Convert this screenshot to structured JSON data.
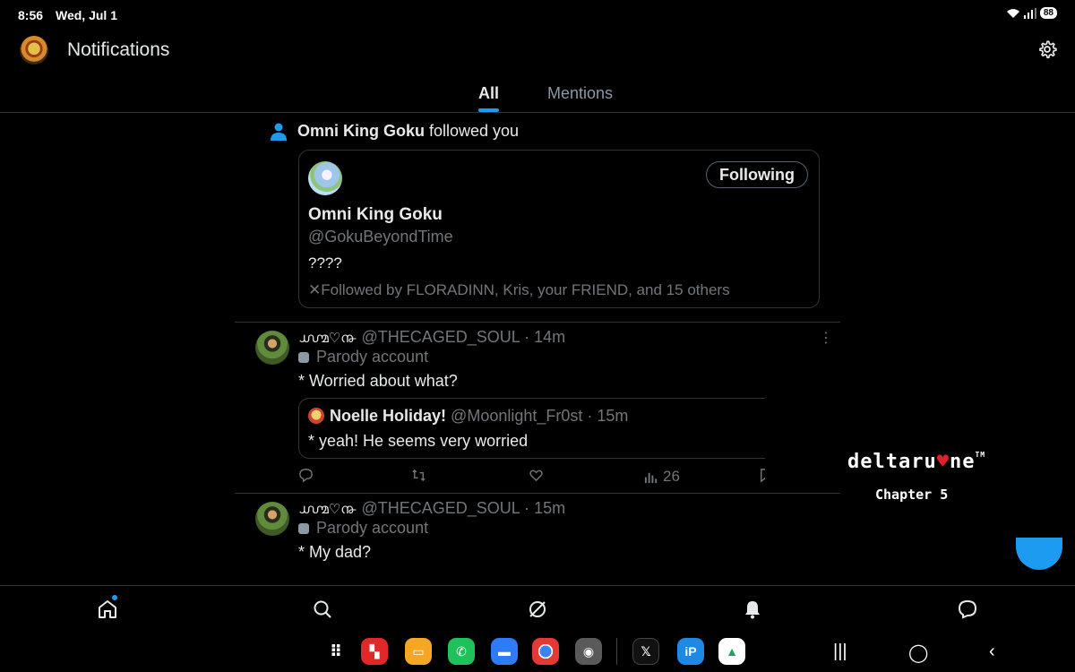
{
  "status_bar": {
    "time": "8:56",
    "date": "Wed, Jul 1",
    "battery": "88"
  },
  "header": {
    "title": "Notifications"
  },
  "tabs": [
    {
      "label": "All",
      "active": true
    },
    {
      "label": "Mentions",
      "active": false
    }
  ],
  "follow_notification": {
    "name": "Omni King Goku",
    "text": "followed you",
    "card": {
      "name": "Omni King Goku",
      "handle": "@GokuBeyondTime",
      "bio": "????",
      "following_label": "Following",
      "followed_by": "✕Followed by FLORADINN, Kris, your FRIEND, and 15 others"
    }
  },
  "tweets": [
    {
      "deco": "൸♡൹",
      "handle": "@THECAGED_SOUL",
      "time": "· 14m",
      "label": "Parody account",
      "text": "* Worried about what?",
      "quote": {
        "name": "Noelle Holiday!",
        "handle": "@Moonlight_Fr0st",
        "time": "· 15m",
        "text": "* yeah! He seems very worried"
      },
      "views": "26"
    },
    {
      "deco": "൸♡൹",
      "handle": "@THECAGED_SOUL",
      "time": "· 15m",
      "label": "Parody account",
      "text": "* My dad?"
    }
  ],
  "overlay": {
    "logo_left": "deltaru",
    "logo_heart": "♥",
    "logo_right": "ne",
    "tm": "TM",
    "chapter": "Chapter 5"
  },
  "colors": {
    "accent": "#1d9bf0",
    "muted": "#71767b",
    "border": "#2f3336"
  },
  "bottom_nav": [
    "home-icon",
    "search-icon",
    "grok-icon",
    "bell-icon",
    "messages-icon"
  ],
  "dock_apps": [
    "apps-grid-icon",
    "flipboard",
    "files",
    "phone",
    "messages",
    "chrome",
    "camera",
    "x",
    "ibis-paint",
    "drive"
  ],
  "system_nav": [
    "recents-icon",
    "home-button-icon",
    "back-icon"
  ]
}
